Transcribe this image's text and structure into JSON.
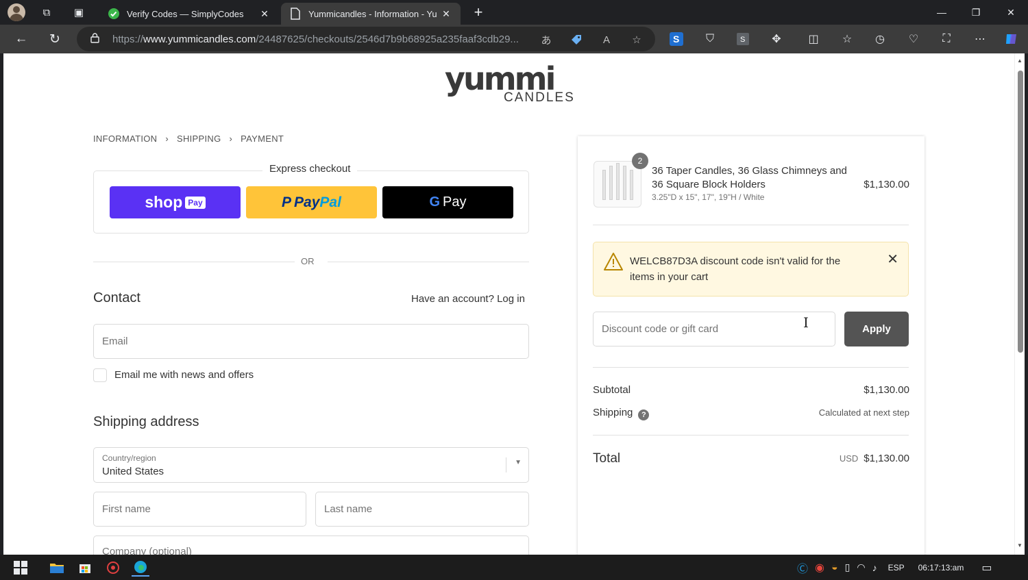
{
  "browser": {
    "tabs": [
      {
        "title": "Verify Codes — SimplyCodes",
        "active": false
      },
      {
        "title": "Yummicandles - Information - Yu",
        "active": true
      }
    ],
    "url_prefix": "https://",
    "url_domain": "www.yummicandles.com",
    "url_path": "/24487625/checkouts/2546d7b9b68925a235faaf3cdb29..."
  },
  "page": {
    "logo": {
      "wordmark": "yummi",
      "sub": "CANDLES"
    },
    "breadcrumbs": [
      "INFORMATION",
      "SHIPPING",
      "PAYMENT"
    ],
    "express": {
      "legend": "Express checkout",
      "shop_label": "shop",
      "shop_pay": "Pay",
      "paypal_1": "Pay",
      "paypal_2": "Pal",
      "gpay_g": "G",
      "gpay_label": "Pay"
    },
    "or": "OR",
    "contact": {
      "heading": "Contact",
      "login": "Have an account? Log in",
      "email_placeholder": "Email",
      "news_label": "Email me with news and offers"
    },
    "shipping": {
      "heading": "Shipping address",
      "country_label": "Country/region",
      "country_value": "United States",
      "first_name_placeholder": "First name",
      "last_name_placeholder": "Last name",
      "company_placeholder": "Company (optional)"
    }
  },
  "summary": {
    "item": {
      "quantity": "2",
      "name": "36 Taper Candles, 36 Glass Chimneys and 36 Square Block Holders",
      "variant": "3.25\"D x 15\", 17\", 19\"H / White",
      "price": "$1,130.00"
    },
    "warning": "WELCB87D3A discount code isn't valid for the items in your cart",
    "discount_placeholder": "Discount code or gift card",
    "apply_label": "Apply",
    "subtotal_label": "Subtotal",
    "subtotal_value": "$1,130.00",
    "shipping_label": "Shipping",
    "shipping_value": "Calculated at next step",
    "total_label": "Total",
    "total_currency": "USD",
    "total_value": "$1,130.00"
  },
  "taskbar": {
    "language": "ESP",
    "time": "06:17:13:am"
  },
  "colors": {
    "shop_pay": "#5a31f4",
    "paypal": "#ffc439",
    "gpay": "#000000",
    "warning_bg": "#fff8e1",
    "apply_bg": "#545454"
  }
}
